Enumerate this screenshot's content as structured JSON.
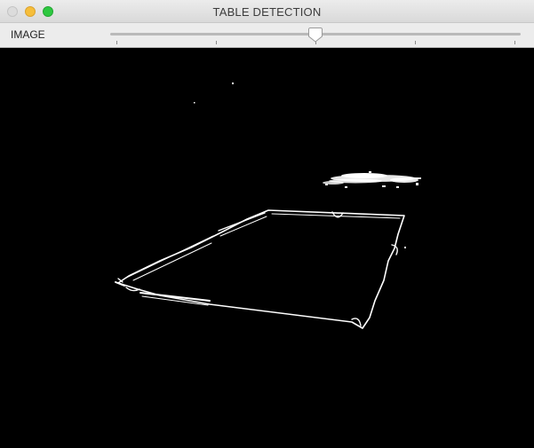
{
  "window": {
    "title": "TABLE DETECTION"
  },
  "toolbar": {
    "trackbar_label": "IMAGE",
    "trackbar_value_fraction": 0.5
  },
  "colors": {
    "titlebar": "#e3e3e3",
    "close": "#dcdcdc",
    "minimize": "#f6be3b",
    "zoom": "#2ec840",
    "canvas": "#000000",
    "edges": "#ffffff"
  }
}
